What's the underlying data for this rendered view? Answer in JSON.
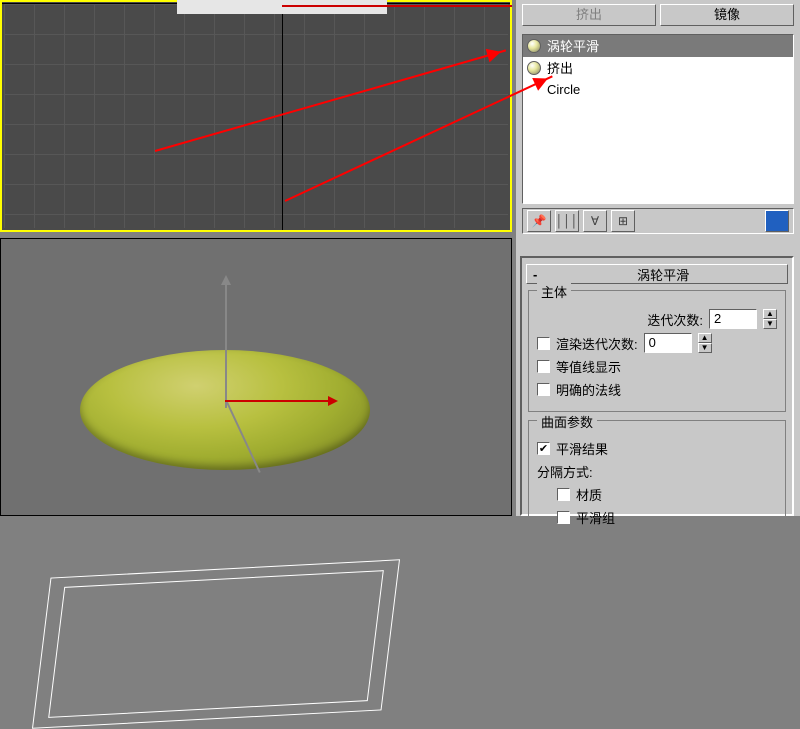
{
  "top_buttons": {
    "extrude": "挤出",
    "mirror": "镜像"
  },
  "modifier_stack": {
    "items": [
      {
        "label": "涡轮平滑",
        "selected": true
      },
      {
        "label": "挤出",
        "selected": false
      },
      {
        "label": "Circle",
        "selected": false
      }
    ]
  },
  "rollout": {
    "title": "涡轮平滑",
    "group_main": "主体",
    "iterations_label": "迭代次数:",
    "iterations_value": "2",
    "render_iter_label": "渲染迭代次数:",
    "render_iter_value": "0",
    "isoline_label": "等值线显示",
    "explicit_normals_label": "明确的法线",
    "group_surface": "曲面参数",
    "smooth_result_label": "平滑结果",
    "separate_label": "分隔方式:",
    "material_label": "材质",
    "smoothgroup_label": "平滑组"
  },
  "icons": {
    "pin": "📌",
    "stack1": "│││",
    "stack2": "∀",
    "stack3": "⊞",
    "config": "▦"
  }
}
